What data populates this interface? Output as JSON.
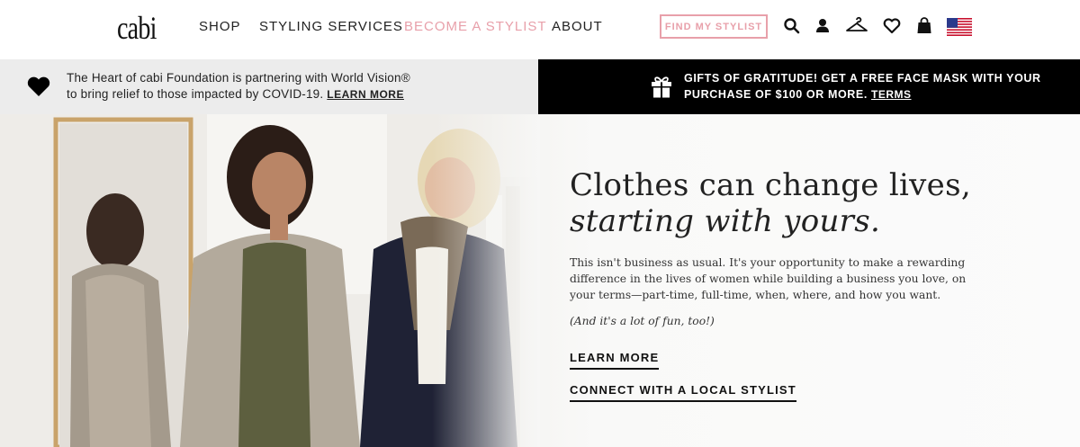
{
  "brand": {
    "logo_text": "cabi"
  },
  "nav": {
    "items": [
      {
        "label": "SHOP"
      },
      {
        "label": "STYLING SERVICES"
      },
      {
        "label": "BECOME A STYLIST",
        "highlighted": true
      },
      {
        "label": "ABOUT"
      }
    ],
    "find_stylist_label": "FIND MY STYLIST",
    "icons": [
      "search-icon",
      "account-icon",
      "hanger-icon",
      "wishlist-heart-icon",
      "shopping-bag-icon",
      "us-flag-icon"
    ]
  },
  "banner_left": {
    "line1": "The Heart of cabi Foundation is partnering with World Vision®",
    "line2": "to bring relief to those impacted by COVID-19.",
    "link": "LEARN MORE",
    "icon": "heart-icon"
  },
  "banner_right": {
    "line1": "GIFTS OF GRATITUDE! GET A FREE FACE MASK WITH YOUR",
    "line2": "PURCHASE OF $100 OR MORE.",
    "link": "TERMS",
    "icon": "gift-icon"
  },
  "hero": {
    "title_line1": "Clothes can change lives,",
    "title_line2": "starting with yours.",
    "body_line1": "This isn't business as usual. It's your opportunity to make a rewarding",
    "body_line2": "difference in the lives of women while building a business you love, on",
    "body_line3": "your terms—part-time, full-time, when, where, and how you want.",
    "aside": "(And it's a lot of fun, too!)",
    "cta_primary": "LEARN MORE",
    "cta_secondary": "CONNECT WITH A LOCAL STYLIST"
  },
  "colors": {
    "accent_pink": "#e8a0aa",
    "banner_dark": "#000000",
    "banner_light": "#ececec"
  }
}
